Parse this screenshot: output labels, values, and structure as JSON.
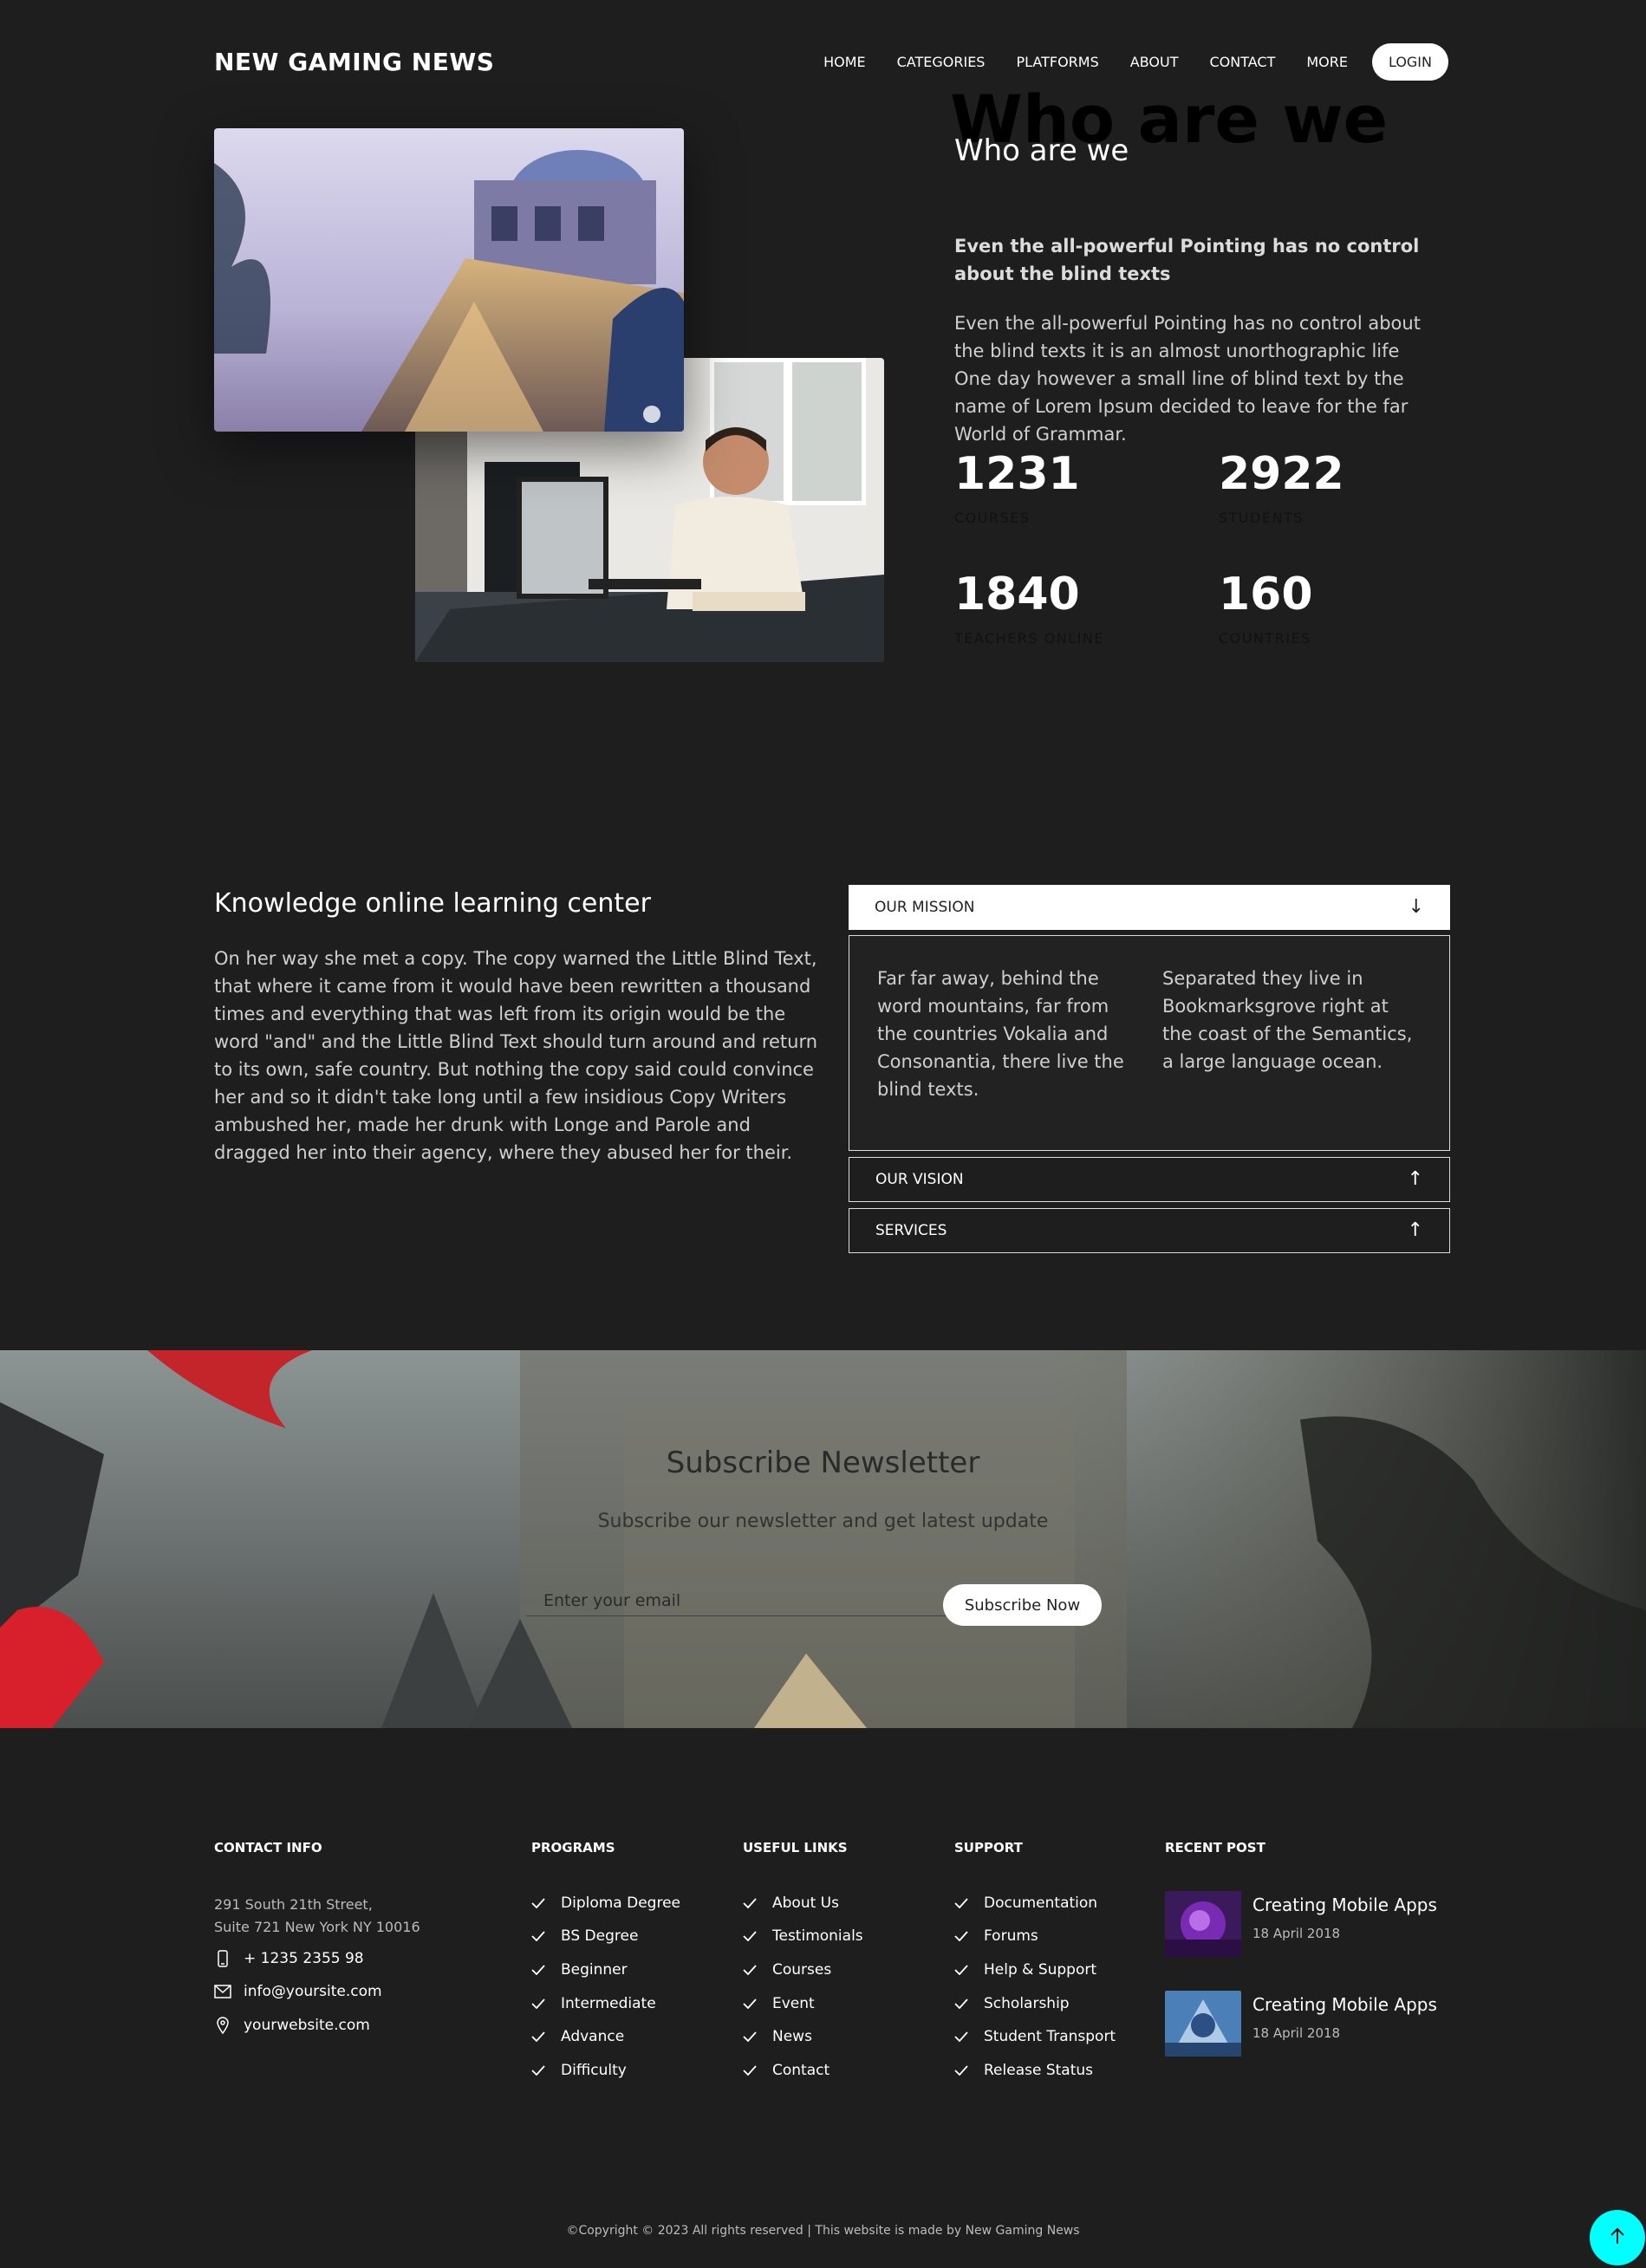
{
  "brand": "NEW GAMING NEWS",
  "nav": {
    "items": [
      "HOME",
      "CATEGORIES",
      "PLATFORMS",
      "ABOUT",
      "CONTACT",
      "MORE"
    ],
    "login": "LOGIN"
  },
  "about": {
    "bg_title": "Who are we",
    "title": "Who are we",
    "lead": "Even the all-powerful Pointing has no control about the blind texts",
    "paragraph": "Even the all-powerful Pointing has no control about the blind texts it is an almost unorthographic life One day however a small line of blind text by the name of Lorem Ipsum decided to leave for the far World of Grammar.",
    "stats": [
      {
        "number": "1231",
        "label": "COURSES"
      },
      {
        "number": "2922",
        "label": "STUDENTS"
      },
      {
        "number": "1840",
        "label": "TEACHERS ONLINE"
      },
      {
        "number": "160",
        "label": "COUNTRIES"
      }
    ]
  },
  "knowledge": {
    "title": "Knowledge online learning center",
    "text": "On her way she met a copy. The copy warned the Little Blind Text, that where it came from it would have been rewritten a thousand times and everything that was left from its origin would be the word \"and\" and the Little Blind Text should turn around and return to its own, safe country. But nothing the copy said could convince her and so it didn't take long until a few insidious Copy Writers ambushed her, made her drunk with Longe and Parole and dragged her into their agency, where they abused her for their."
  },
  "accordion": {
    "mission": "OUR MISSION",
    "mission_col1": "Far far away, behind the word mountains, far from the countries Vokalia and Consonantia, there live the blind texts.",
    "mission_col2": "Separated they live in Bookmarksgrove right at the coast of the Semantics, a large language ocean.",
    "vision": "OUR VISION",
    "services": "SERVICES"
  },
  "newsletter": {
    "title": "Subscribe Newsletter",
    "subtitle": "Subscribe our newsletter and get latest update",
    "placeholder": "Enter your email",
    "button": "Subscribe Now"
  },
  "footer": {
    "contact": {
      "heading": "CONTACT INFO",
      "address_line1": "291 South 21th Street,",
      "address_line2": "Suite 721 New York NY 10016",
      "phone": "+ 1235 2355 98",
      "email": "info@yoursite.com",
      "website": "yourwebsite.com"
    },
    "programs": {
      "heading": "PROGRAMS",
      "items": [
        "Diploma Degree",
        "BS Degree",
        "Beginner",
        "Intermediate",
        "Advance",
        "Difficulty"
      ]
    },
    "useful_links": {
      "heading": "USEFUL LINKS",
      "items": [
        "About Us",
        "Testimonials",
        "Courses",
        "Event",
        "News",
        "Contact"
      ]
    },
    "support": {
      "heading": "SUPPORT",
      "items": [
        "Documentation",
        "Forums",
        "Help & Support",
        "Scholarship",
        "Student Transport",
        "Release Status"
      ]
    },
    "recent_post": {
      "heading": "RECENT POST",
      "posts": [
        {
          "title": "Creating Mobile Apps",
          "date": "18 April 2018"
        },
        {
          "title": "Creating Mobile Apps",
          "date": "18 April 2018"
        }
      ]
    },
    "copyright": "©Copyright © 2023 All rights reserved | This website is made by New Gaming News"
  },
  "colors": {
    "background": "#1e1e1e",
    "accent_totop": "#00ffff",
    "white": "#ffffff"
  }
}
